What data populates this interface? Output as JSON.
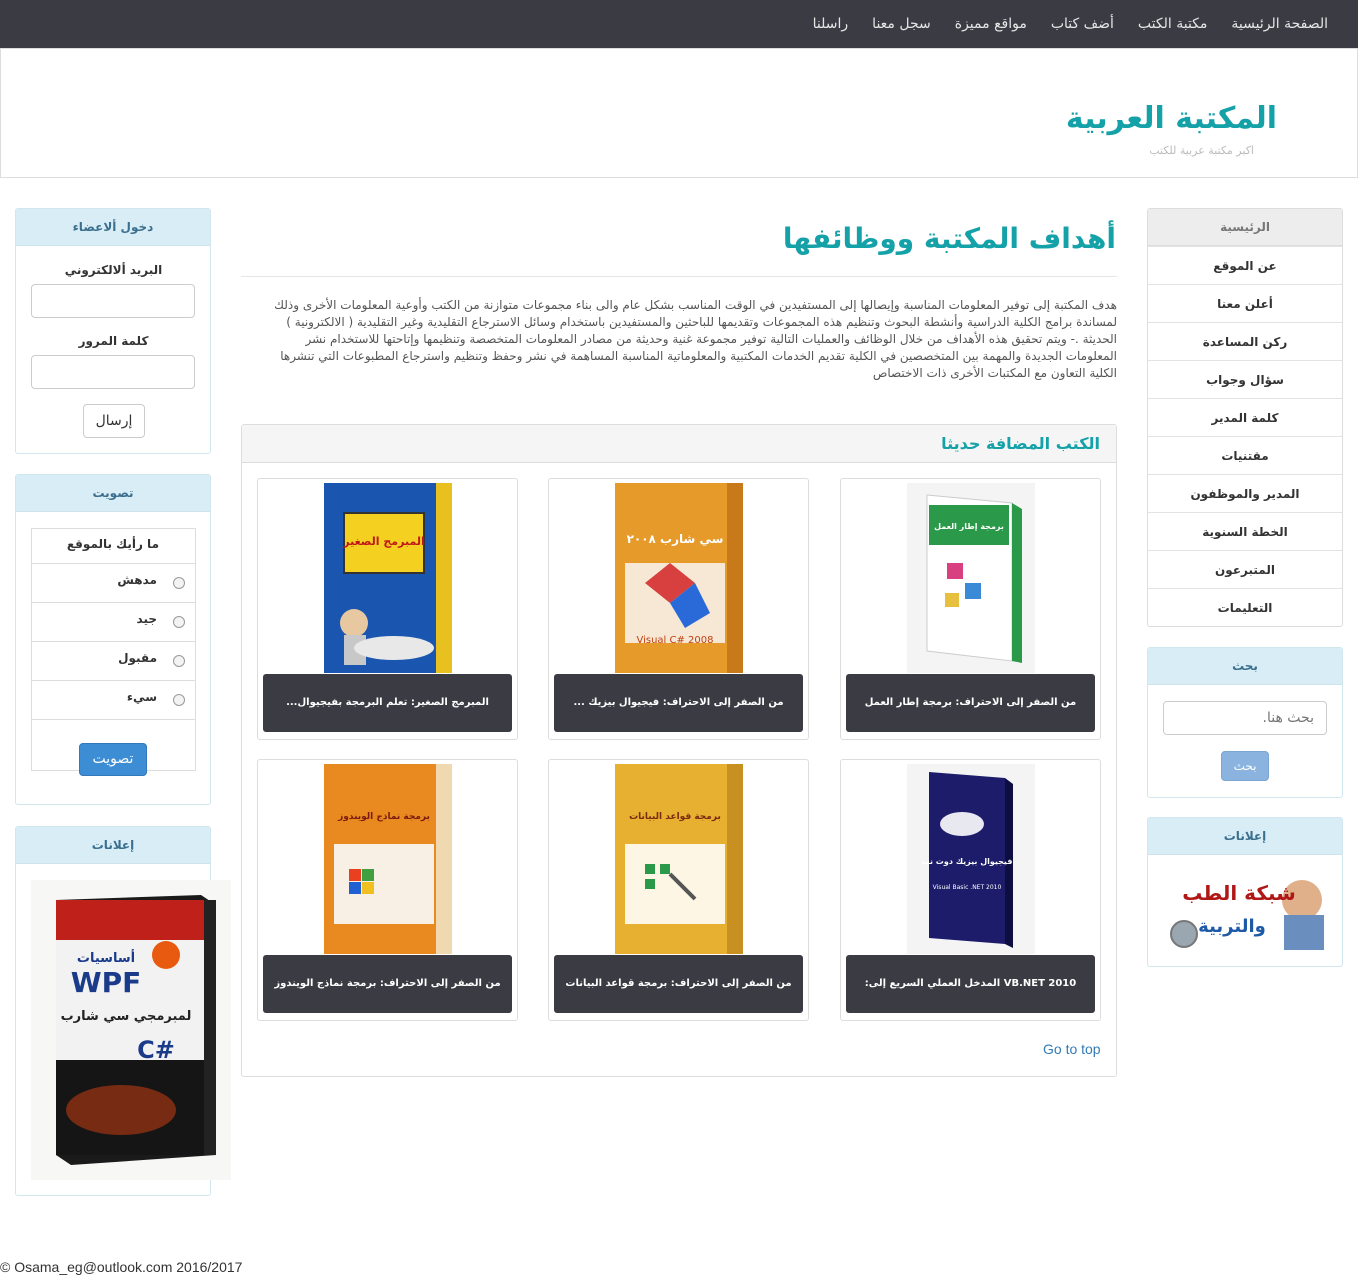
{
  "nav": {
    "items": [
      "الصفحة الرئيسية",
      "مكتبة الكتب",
      "أضف كتاب",
      "مواقع مميزة",
      "سجل معنا",
      "راسلنا"
    ]
  },
  "header": {
    "title": "المكتبة العربية",
    "subtitle": "اكبر مكتبة عربية للكتب"
  },
  "right_menu": {
    "heading": "الرئيسية",
    "items": [
      "عن الموقع",
      "أعلن معنا",
      "ركن المساعدة",
      "سؤال وجواب",
      "كلمة المدير",
      "مقتنيات",
      "المدير والموظفون",
      "الخطة السنوية",
      "المتبرعون",
      "التعليمات"
    ]
  },
  "search": {
    "heading": "بحث",
    "placeholder": "بحث هنا.",
    "button": "بحث"
  },
  "ads_right": {
    "heading": "إعلانات",
    "ad_text_1": "شبكة الطب",
    "ad_text_2": "والتربية"
  },
  "login": {
    "heading": "دخول ألاعضاء",
    "email_label": "البريد ألالكتروني",
    "password_label": "كلمة المرور",
    "submit": "إرسال"
  },
  "poll": {
    "heading": "تصويت",
    "question": "ما رأيك بالموقع",
    "options": [
      "مدهش",
      "جيد",
      "مقبول",
      "سيء"
    ],
    "button": "تصويت"
  },
  "ads_left": {
    "heading": "إعلانات",
    "book_title": "أساسيات",
    "book_big": "WPF",
    "book_sub": "لمبرمجي سي شارب",
    "book_cs": "C#"
  },
  "main": {
    "title": "أهداف المكتبة ووظائفها",
    "paragraph": "هدف المكتبة إلى توفير المعلومات المناسبة وإيصالها إلى المستفيدين في الوقت المناسب بشكل عام والى بناء مجموعات متوازنة من الكتب وأوعية المعلومات الأخرى وذلك لمساندة برامج الكلية الدراسية وأنشطة البحوث وتنظيم هذه المجموعات وتقديمها للباحثين والمستفيدين باستخدام وسائل الاسترجاع التقليدية وغير التقليدية ( الالكترونية ) الحديثة .- ويتم تحقيق هذه الأهداف من خلال الوظائف والعمليات التالية توفير مجموعة غنية وحديثة من مصادر المعلومات المتخصصة وتنظيمها وإتاحتها للاستخدام نشر المعلومات الجديدة والمهمة بين المتخصصين في الكلية تقديم الخدمات المكتبية والمعلوماتية المناسبة المساهمة في نشر وحفظ وتنظيم واسترجاع المطبوعات التي تنشرها الكلية التعاون مع المكتبات الأخرى ذات الاختصاص"
  },
  "books": {
    "heading": "الكتب المضافة حديثا",
    "items": [
      {
        "caption": "من الصفر إلى الاحتراف: برمجة إطار العمل",
        "cover_color": "#2a9a4a",
        "cover_text": "برمجة إطار العمل"
      },
      {
        "caption": "من الصفر إلى الاحتراف: فيجيوال بيزيك ...",
        "cover_color": "#e59a2a",
        "cover_text": "سي شارب ٢٠٠٨"
      },
      {
        "caption": "المبرمج الصغير: تعلم البرمجة بفيجيوال...",
        "cover_color": "#1a56b0",
        "cover_text": "المبرمج الصغير"
      },
      {
        "caption": "VB.NET 2010 المدخل العملي السريع إلى:",
        "cover_color": "#1c1c6a",
        "cover_text": "فيجيوال بيزيك دوت نت"
      },
      {
        "caption": "من الصفر إلى الاحتراف: برمجة قواعد البيانات",
        "cover_color": "#e8b030",
        "cover_text": "برمجة قواعد البيانات"
      },
      {
        "caption": "من الصفر إلى الاحتراف: برمجة نماذج الويندوز",
        "cover_color": "#e88a20",
        "cover_text": "برمجة نماذج الويندوز"
      }
    ],
    "go_top": "Go to top"
  },
  "footer": {
    "text": "© Osama_eg@outlook.com 2016/2017"
  }
}
